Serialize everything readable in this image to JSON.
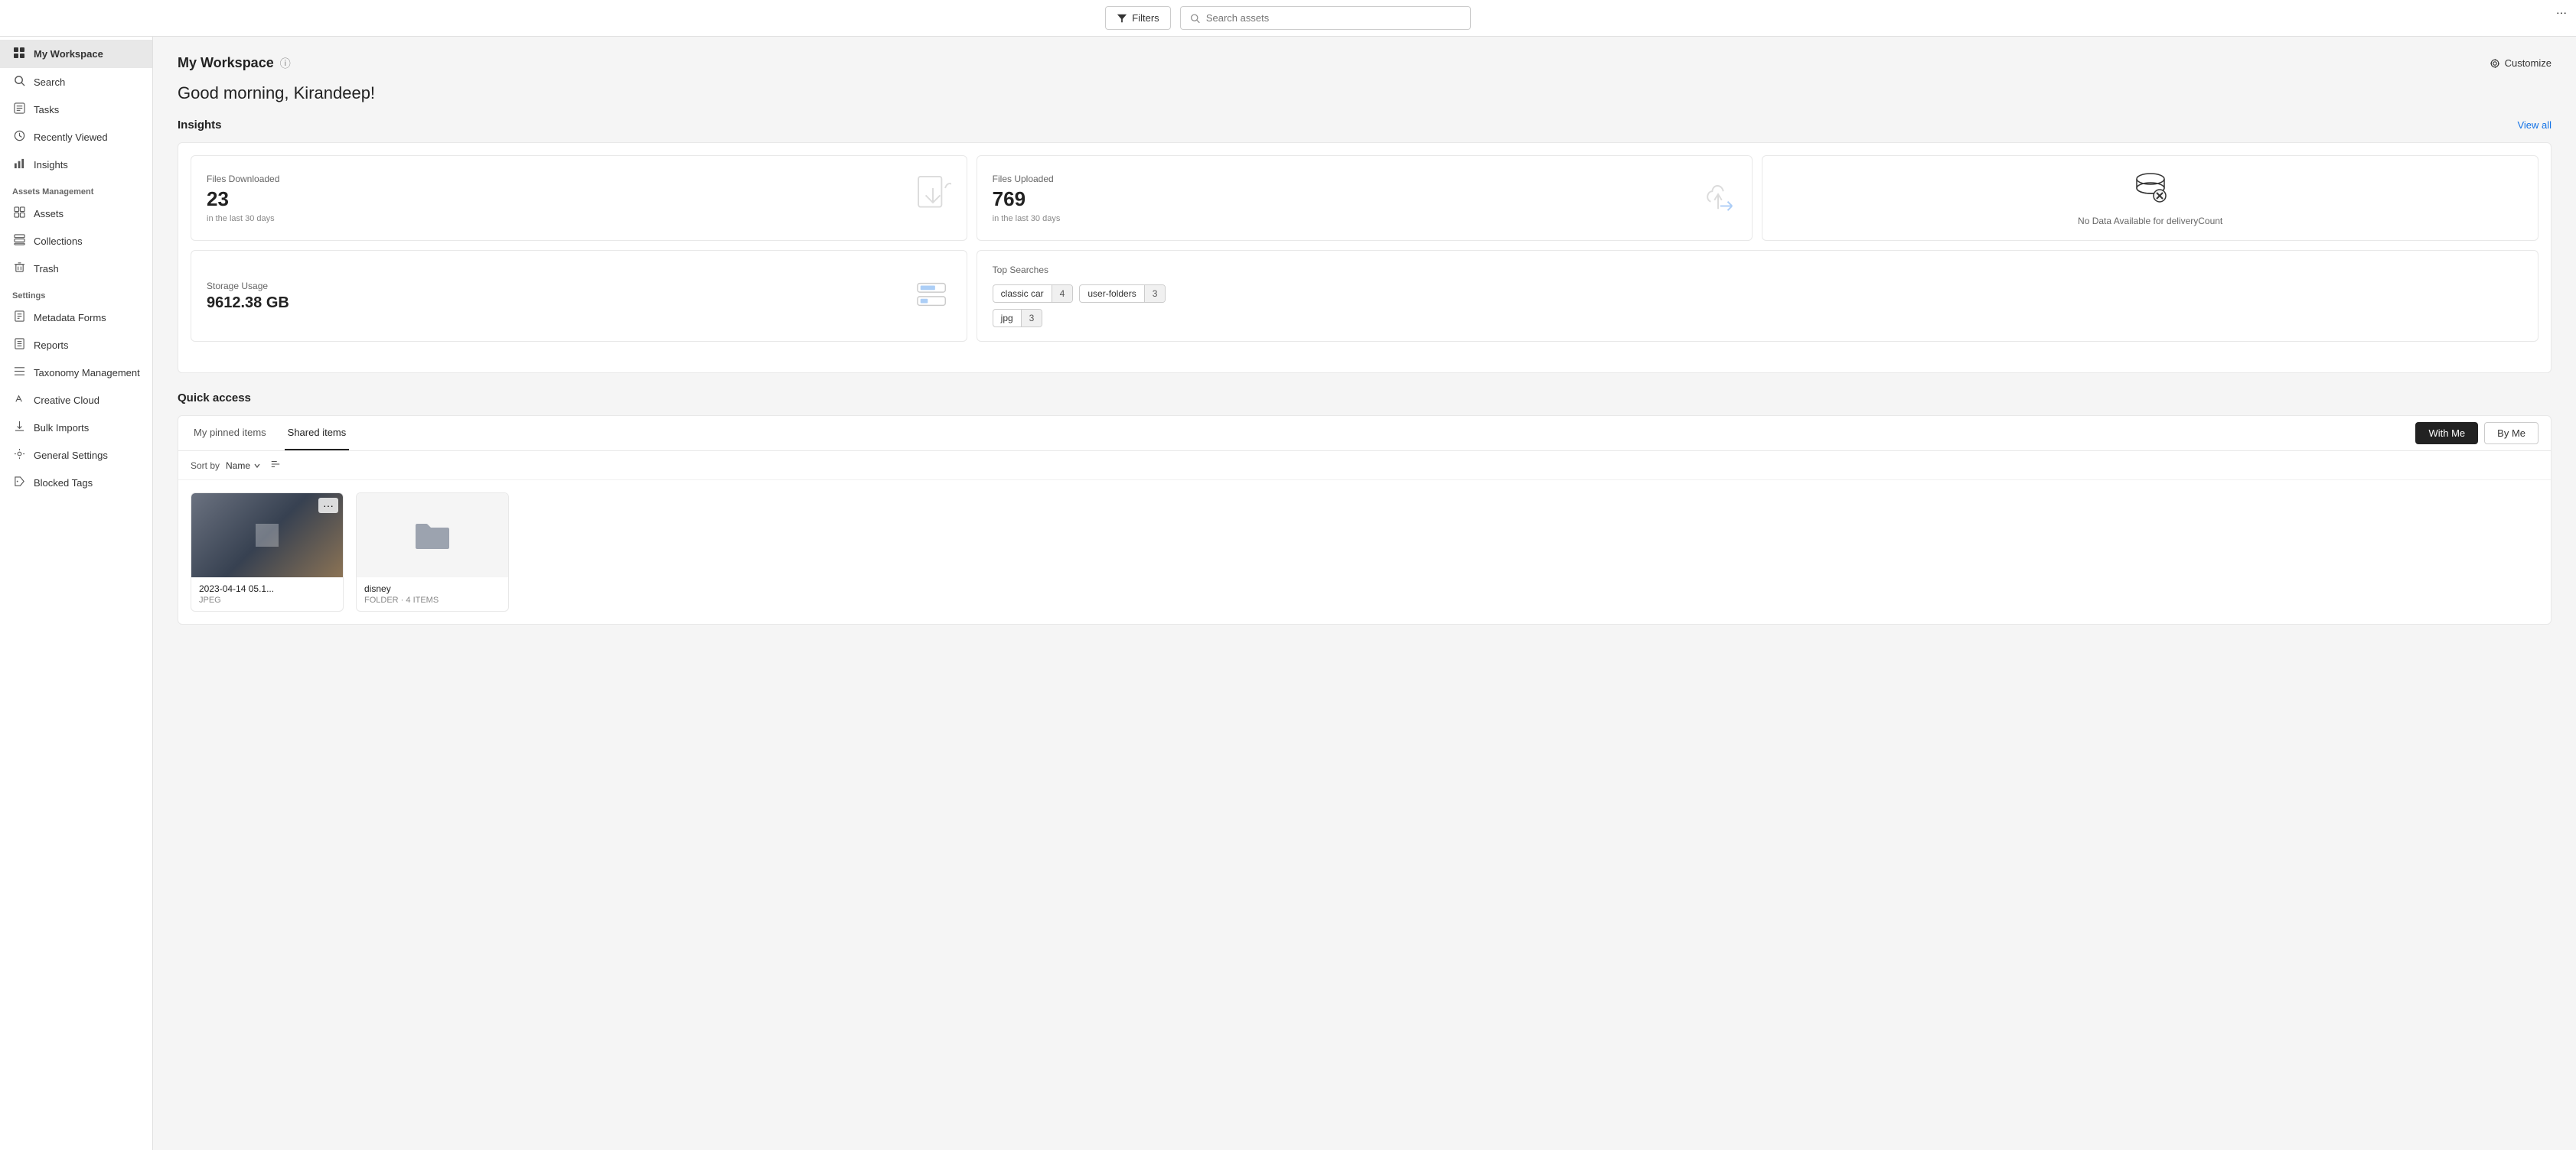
{
  "topbar": {
    "filters_label": "Filters",
    "search_placeholder": "Search assets"
  },
  "sidebar": {
    "items_top": [
      {
        "id": "my-workspace",
        "label": "My Workspace",
        "icon": "⊟",
        "active": true
      },
      {
        "id": "search",
        "label": "Search",
        "icon": "🔍"
      },
      {
        "id": "tasks",
        "label": "Tasks",
        "icon": "✔"
      },
      {
        "id": "recently-viewed",
        "label": "Recently Viewed",
        "icon": "🕐"
      },
      {
        "id": "insights",
        "label": "Insights",
        "icon": "📊"
      }
    ],
    "section_assets": "Assets Management",
    "items_assets": [
      {
        "id": "assets",
        "label": "Assets",
        "icon": "▦"
      },
      {
        "id": "collections",
        "label": "Collections",
        "icon": "⊞"
      },
      {
        "id": "trash",
        "label": "Trash",
        "icon": "🗑"
      }
    ],
    "section_settings": "Settings",
    "items_settings": [
      {
        "id": "metadata-forms",
        "label": "Metadata Forms",
        "icon": "≡"
      },
      {
        "id": "reports",
        "label": "Reports",
        "icon": "📋"
      },
      {
        "id": "taxonomy-management",
        "label": "Taxonomy Management",
        "icon": "≣"
      },
      {
        "id": "creative-cloud",
        "label": "Creative Cloud",
        "icon": "✏"
      },
      {
        "id": "bulk-imports",
        "label": "Bulk Imports",
        "icon": "⬇"
      },
      {
        "id": "general-settings",
        "label": "General Settings",
        "icon": "⚙"
      },
      {
        "id": "blocked-tags",
        "label": "Blocked Tags",
        "icon": "🏷"
      }
    ]
  },
  "main": {
    "page_title": "My Workspace",
    "customize_label": "Customize",
    "greeting": "Good morning, Kirandeep!",
    "insights": {
      "section_title": "Insights",
      "view_all": "View all",
      "cards": [
        {
          "id": "files-downloaded",
          "label": "Files Downloaded",
          "value": "23",
          "sub": "in the last 30 days",
          "icon": "download"
        },
        {
          "id": "files-uploaded",
          "label": "Files Uploaded",
          "value": "769",
          "sub": "in the last 30 days",
          "icon": "upload"
        },
        {
          "id": "delivery-count",
          "label": "",
          "no_data_text": "No Data Available for deliveryCount",
          "icon": "database-no"
        }
      ],
      "storage": {
        "label": "Storage Usage",
        "value": "9612.38 GB",
        "icon": "storage"
      },
      "top_searches": {
        "label": "Top Searches",
        "tags": [
          {
            "name": "classic car",
            "count": "4"
          },
          {
            "name": "user-folders",
            "count": "3"
          },
          {
            "name": "jpg",
            "count": "3"
          }
        ]
      }
    },
    "quick_access": {
      "title": "Quick access",
      "tabs": [
        {
          "id": "my-pinned",
          "label": "My pinned items",
          "active": false
        },
        {
          "id": "shared-items",
          "label": "Shared items",
          "active": true
        }
      ],
      "with_me": "With Me",
      "by_me": "By Me",
      "sort_label": "Sort by",
      "sort_value": "Name",
      "files": [
        {
          "id": "file-1",
          "name": "2023-04-14 05.1...",
          "type": "JPEG",
          "thumbnail": true
        },
        {
          "id": "file-2",
          "name": "disney",
          "type": "FOLDER · 4 ITEMS",
          "thumbnail": false
        }
      ]
    }
  }
}
